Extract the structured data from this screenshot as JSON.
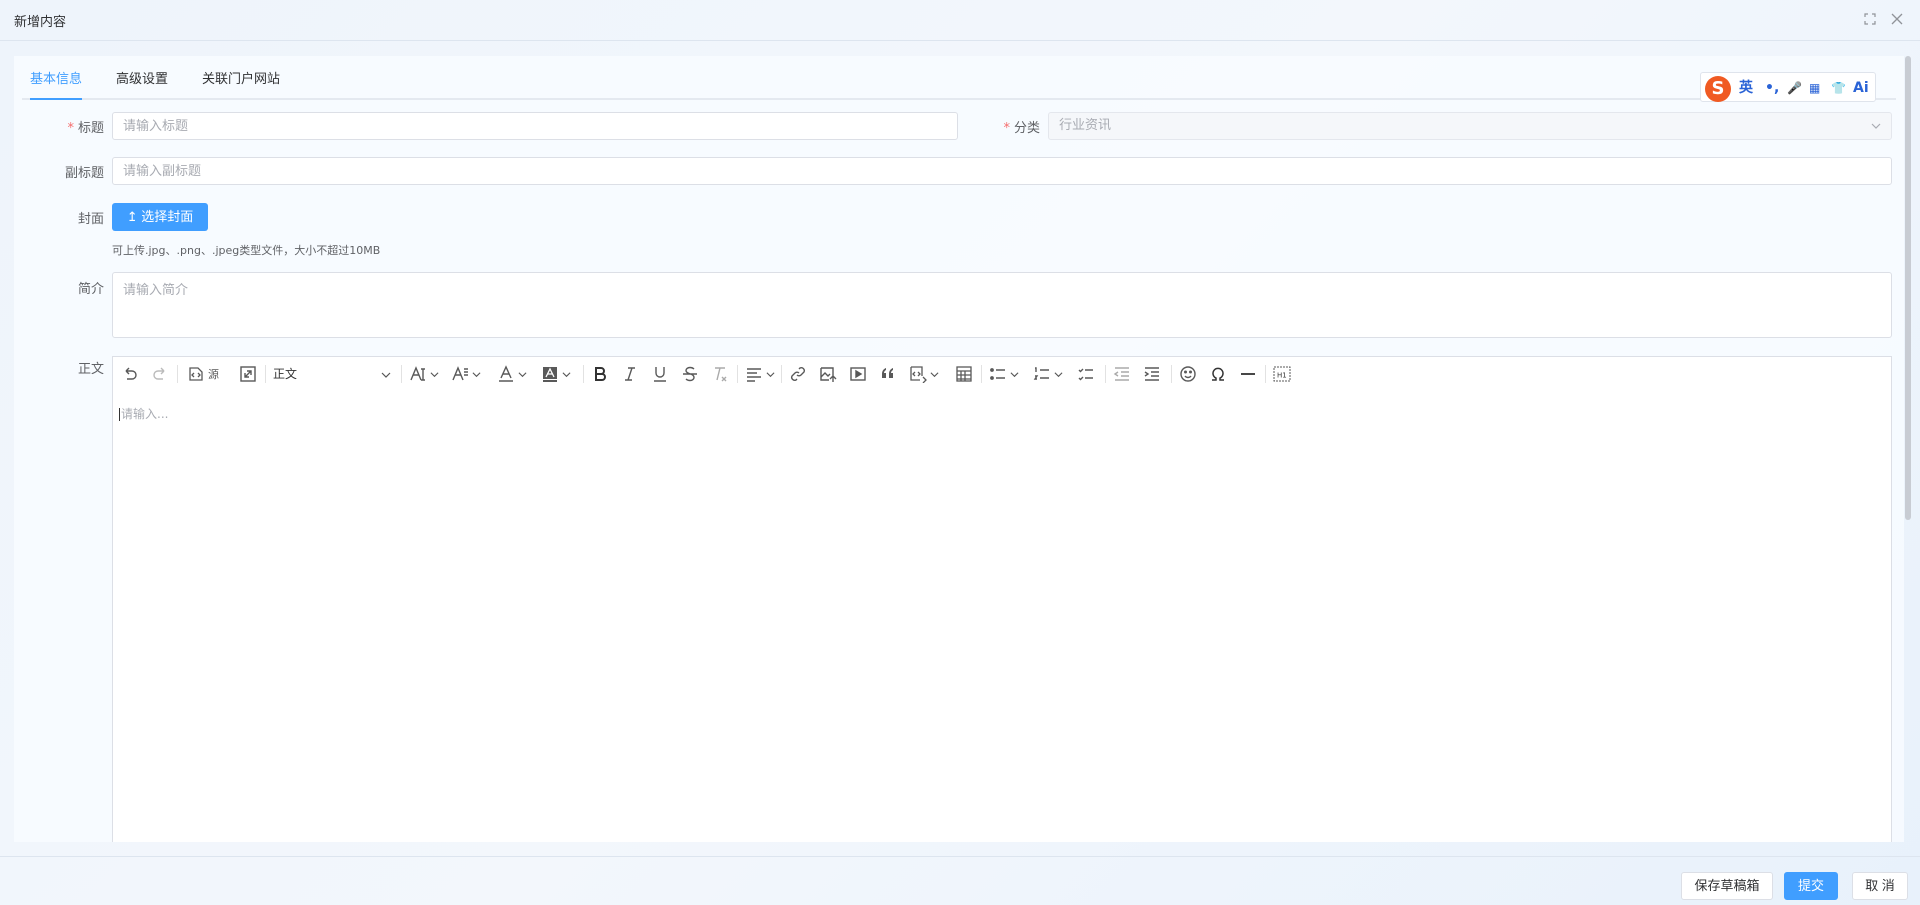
{
  "window": {
    "title": "新增内容"
  },
  "tabs": [
    {
      "label": "基本信息",
      "active": true
    },
    {
      "label": "高级设置",
      "active": false
    },
    {
      "label": "关联门户网站",
      "active": false
    }
  ],
  "ime": {
    "logo": "S",
    "items": [
      "英",
      "•,",
      "🎤",
      "▦",
      "👕",
      "Ai"
    ]
  },
  "form": {
    "title_label": "标题",
    "title_placeholder": "请输入标题",
    "category_label": "分类",
    "category_value": "行业资讯",
    "subtitle_label": "副标题",
    "subtitle_placeholder": "请输入副标题",
    "cover_label": "封面",
    "cover_button": "选择封面",
    "cover_hint": "可上传.jpg、.png、.jpeg类型文件，大小不超过10MB",
    "summary_label": "简介",
    "summary_placeholder": "请输入简介",
    "body_label": "正文",
    "required_mark": "*"
  },
  "editor": {
    "source_label": "源",
    "paragraph_style": "正文",
    "placeholder": "请输入..."
  },
  "footer": {
    "save_draft": "保存草稿箱",
    "submit": "提交",
    "cancel": "取 消"
  },
  "colors": {
    "primary": "#409eff",
    "required": "#f56c6c"
  }
}
